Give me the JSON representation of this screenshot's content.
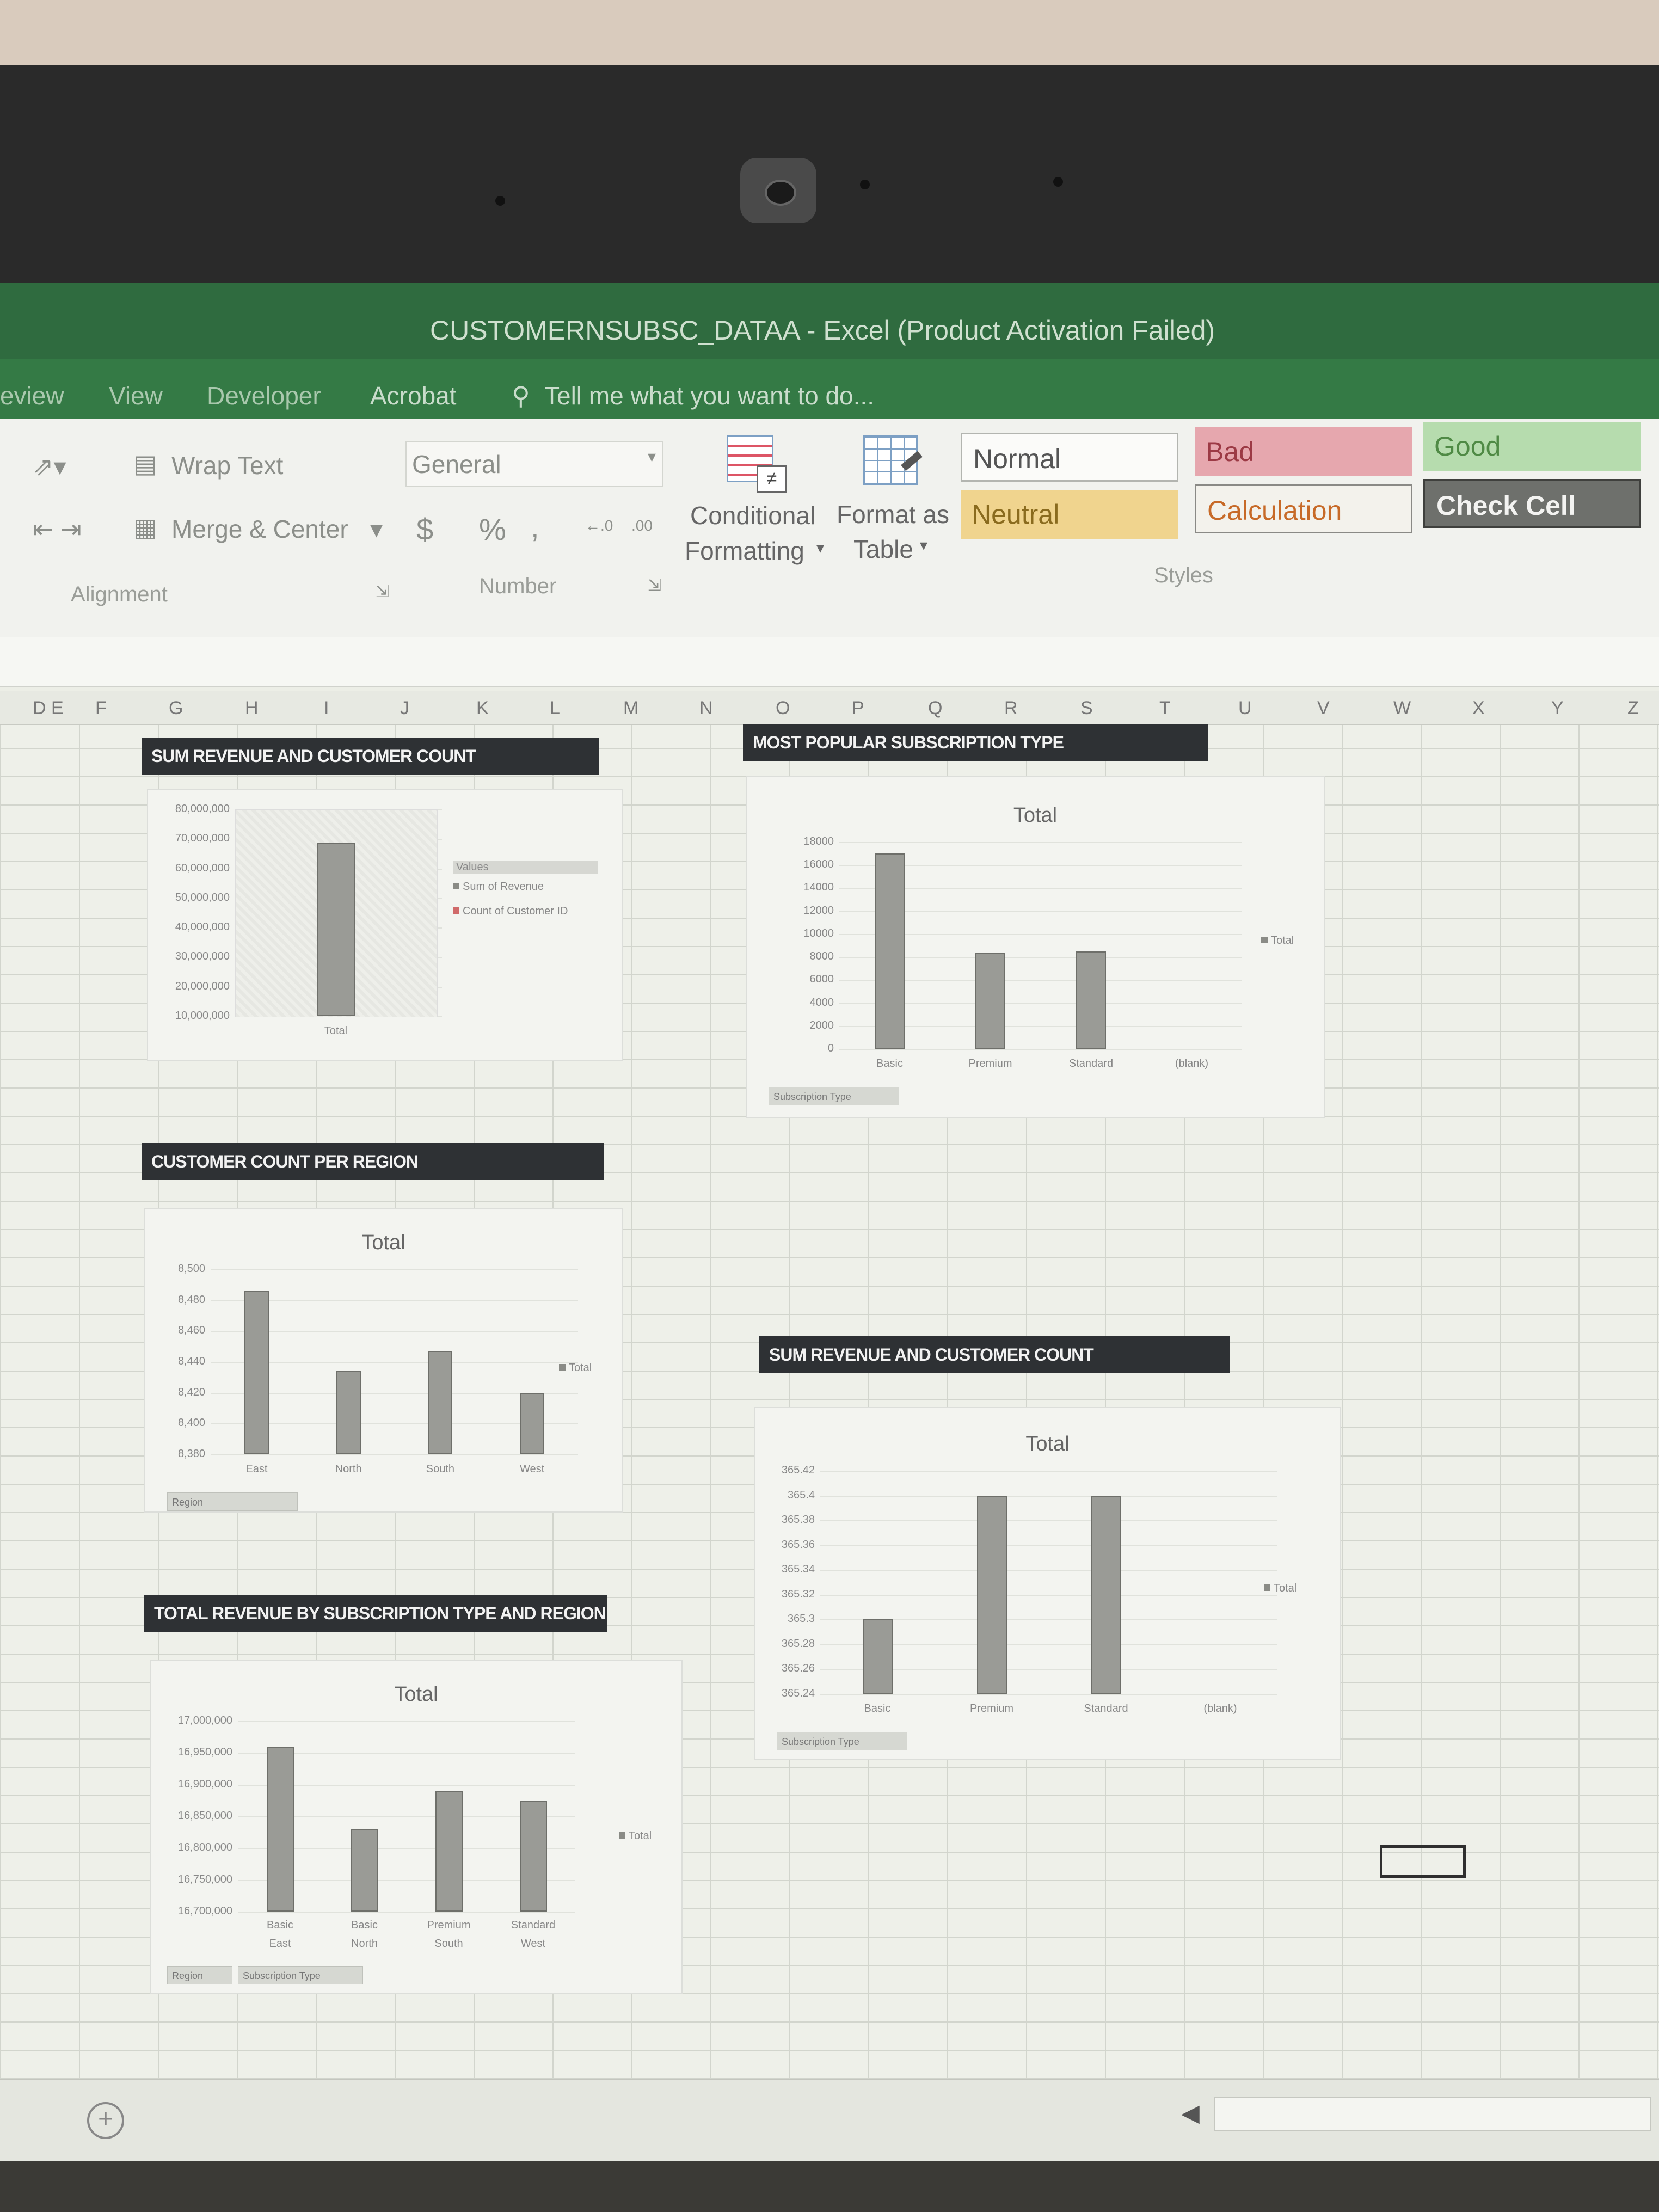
{
  "window": {
    "title": "CUSTOMERNSUBSC_DATAA - Excel (Product Activation Failed)"
  },
  "menu": {
    "items": [
      "eview",
      "View",
      "Developer",
      "Acrobat"
    ],
    "tell_me": "Tell me what you want to do..."
  },
  "ribbon": {
    "wrap_text": "Wrap Text",
    "merge_center": "Merge & Center",
    "alignment_label": "Alignment",
    "number_format": "General",
    "currency": "$",
    "percent": "%",
    "comma": ",",
    "number_label": "Number",
    "conditional_formatting": [
      "Conditional",
      "Formatting"
    ],
    "format_as_table": [
      "Format as",
      "Table"
    ],
    "styles": {
      "normal": "Normal",
      "bad": "Bad",
      "good": "Good",
      "neutral": "Neutral",
      "calculation": "Calculation",
      "check_cell": "Check Cell"
    },
    "styles_label": "Styles"
  },
  "columns": [
    "D E",
    "F",
    "G",
    "H",
    "I",
    "J",
    "K",
    "L",
    "M",
    "N",
    "O",
    "P",
    "Q",
    "R",
    "S",
    "T",
    "U",
    "V",
    "W",
    "X",
    "Y",
    "Z"
  ],
  "banners": {
    "b1": "SUM REVENUE AND CUSTOMER COUNT",
    "b2": "MOST POPULAR SUBSCRIPTION TYPE",
    "b3": "CUSTOMER COUNT  PER REGION",
    "b4": "SUM REVENUE AND CUSTOMER COUNT",
    "b5": "TOTAL REVENUE BY SUBSCRIPTION TYPE AND REGION"
  },
  "chart_data": [
    {
      "type": "bar",
      "title": "",
      "categories": [
        "Total"
      ],
      "series": [
        {
          "name": "Sum of Revenue",
          "values": [
            67000000
          ]
        },
        {
          "name": "Count of Customer ID",
          "values": [
            0
          ]
        }
      ],
      "yticks": [
        "80,000,000",
        "70,000,000",
        "60,000,000",
        "50,000,000",
        "40,000,000",
        "30,000,000",
        "20,000,000",
        "10,000,000"
      ],
      "ylim": [
        0,
        80000000
      ],
      "legend_title": "Values",
      "legend_items": [
        "Sum of Revenue",
        "Count of Customer ID"
      ]
    },
    {
      "type": "bar",
      "title": "Total",
      "categories": [
        "Basic",
        "Premium",
        "Standard",
        "(blank)"
      ],
      "values": [
        17000,
        8400,
        8500,
        0
      ],
      "yticks": [
        "18000",
        "16000",
        "14000",
        "12000",
        "10000",
        "8000",
        "6000",
        "4000",
        "2000",
        "0"
      ],
      "ylim": [
        0,
        18000
      ],
      "legend": "Total",
      "filter": "Subscription Type"
    },
    {
      "type": "bar",
      "title": "Total",
      "categories": [
        "East",
        "North",
        "South",
        "West"
      ],
      "values": [
        8486,
        8434,
        8447,
        8420
      ],
      "yticks": [
        "8,500",
        "8,480",
        "8,460",
        "8,440",
        "8,420",
        "8,400",
        "8,380"
      ],
      "ylim": [
        8380,
        8500
      ],
      "legend": "Total",
      "filter": "Region"
    },
    {
      "type": "bar",
      "title": "Total",
      "categories": [
        "Basic",
        "Premium",
        "Standard",
        "(blank)"
      ],
      "values": [
        365.3,
        365.4,
        365.4,
        0
      ],
      "yticks": [
        "365.42",
        "365.4",
        "365.38",
        "365.36",
        "365.34",
        "365.32",
        "365.3",
        "365.28",
        "365.26",
        "365.24"
      ],
      "ylim": [
        365.24,
        365.42
      ],
      "legend": "Total",
      "filter": "Subscription Type"
    },
    {
      "type": "bar",
      "title": "Total",
      "categories": [
        "Basic / East",
        "Basic / North",
        "Premium / South",
        "Standard / West"
      ],
      "xlabels_top": [
        "Basic",
        "Basic",
        "Premium",
        "Standard"
      ],
      "xlabels_bottom": [
        "East",
        "North",
        "South",
        "West"
      ],
      "values": [
        16960000,
        16830000,
        16890000,
        16875000
      ],
      "yticks": [
        "17,000,000",
        "16,950,000",
        "16,900,000",
        "16,850,000",
        "16,800,000",
        "16,750,000",
        "16,700,000"
      ],
      "ylim": [
        16700000,
        17000000
      ],
      "legend": "Total",
      "filters": [
        "Region",
        "Subscription Type"
      ]
    }
  ]
}
